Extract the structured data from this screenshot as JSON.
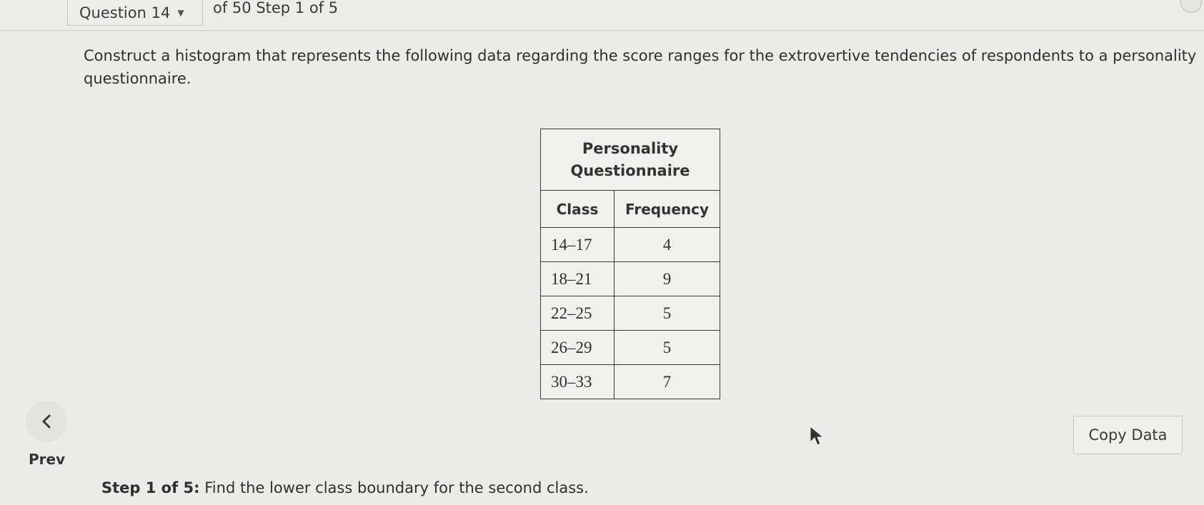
{
  "header": {
    "question_label": "Question 14",
    "progress_text": "of 50 Step 1 of 5"
  },
  "prompt": {
    "text": "Construct a histogram that represents the following data regarding the score ranges for the extrovertive tendencies of respondents to a personality questionnaire."
  },
  "table": {
    "title_line1": "Personality",
    "title_line2": "Questionnaire",
    "col_class": "Class",
    "col_frequency": "Frequency",
    "rows": [
      {
        "class": "14–17",
        "frequency": "4"
      },
      {
        "class": "18–21",
        "frequency": "9"
      },
      {
        "class": "22–25",
        "frequency": "5"
      },
      {
        "class": "26–29",
        "frequency": "5"
      },
      {
        "class": "30–33",
        "frequency": "7"
      }
    ]
  },
  "nav": {
    "prev_label": "Prev"
  },
  "actions": {
    "copy_data_label": "Copy Data"
  },
  "step": {
    "prefix": "Step 1 of 5:",
    "text": "Find the lower class boundary for the second class."
  },
  "icons": {
    "prev": "chevron-left-icon",
    "dropdown": "caret-down-icon",
    "cursor": "mouse-pointer-icon"
  }
}
